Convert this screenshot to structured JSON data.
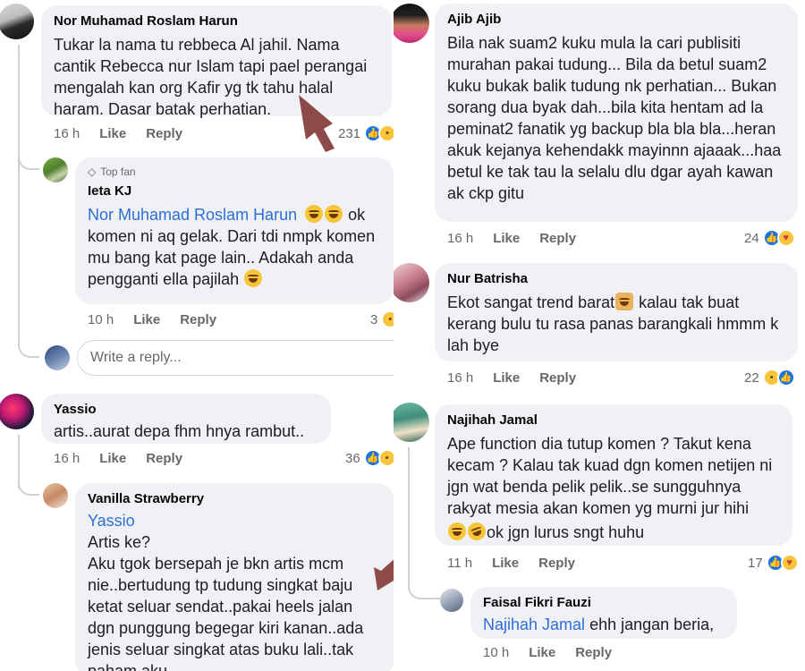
{
  "actions": {
    "like": "Like",
    "reply": "Reply"
  },
  "left": {
    "nor": {
      "name": "Nor Muhamad Roslam Harun",
      "text": "Tukar la nama tu rebbeca Al jahil. Nama cantik Rebecca nur Islam tapi pael perangai mengalah kan org Kafir yg tk tahu halal haram. Dasar batak perhatian.",
      "time": "16 h",
      "reactions": "231"
    },
    "ieta": {
      "badge": "Top fan",
      "name": "Ieta KJ",
      "mention": "Nor Muhamad Roslam Harun",
      "text_after_emoji": " ok komen ni aq gelak.  Dari tdi nmpk komen mu bang kat page lain..  Adakah anda pengganti ella pajilah ",
      "time": "10 h",
      "reactions": "3"
    },
    "write_reply": {
      "placeholder": "Write a reply..."
    },
    "yassio": {
      "name": "Yassio",
      "text": "artis..aurat depa fhm hnya rambut..",
      "time": "16 h",
      "reactions": "36"
    },
    "vanilla": {
      "name": "Vanilla Strawberry",
      "mention": "Yassio",
      "text": "Artis ke?\nAku tgok bersepah je bkn artis mcm nie..bertudung tp tudung singkat baju ketat seluar sendat..pakai heels jalan dgn punggung begegar kiri kanan..ada jenis seluar singkat atas buku lali..tak paham aku.."
    }
  },
  "right": {
    "ajib": {
      "name": "Ajib Ajib",
      "text": "Bila nak suam2 kuku mula  la cari publisiti murahan pakai tudung... Bila da betul suam2 kuku bukak balik tudung nk perhatian... Bukan sorang dua byak dah...bila kita hentam ad la peminat2 fanatik yg backup bla bla bla...heran akuk kejanya kehendakk mayinnn ajaaak...haa betul ke tak tau la selalu dlu dgar ayah kawan ak ckp gitu",
      "time": "16 h",
      "reactions": "24"
    },
    "nurb": {
      "name": "Nur Batrisha",
      "text_before_emoji": "Ekot sangat trend barat",
      "text_after_emoji": " kalau tak buat kerang bulu tu rasa panas barangkali hmmm k lah bye",
      "time": "16 h",
      "reactions": "22"
    },
    "najihah": {
      "name": "Najihah Jamal",
      "text": "Ape function dia tutup komen ? Takut kena kecam ? Kalau tak kuad dgn komen netijen ni jgn wat benda pelik pelik..se sungguhnya rakyat mesia akan komen yg murni jur hihi",
      "text_after_emoji": "ok jgn lurus sngt huhu",
      "time": "11 h",
      "reactions": "17"
    },
    "faisal": {
      "name": "Faisal Fikri Fauzi",
      "mention": "Najihah Jamal",
      "text": " ehh jangan beria,",
      "time": "10 h"
    }
  },
  "colors": {
    "bubble": "#eff1f4",
    "mention": "#2d6ed8",
    "like": "#1b74e4",
    "arrow": "#8e4a48",
    "meta": "#65676b"
  }
}
